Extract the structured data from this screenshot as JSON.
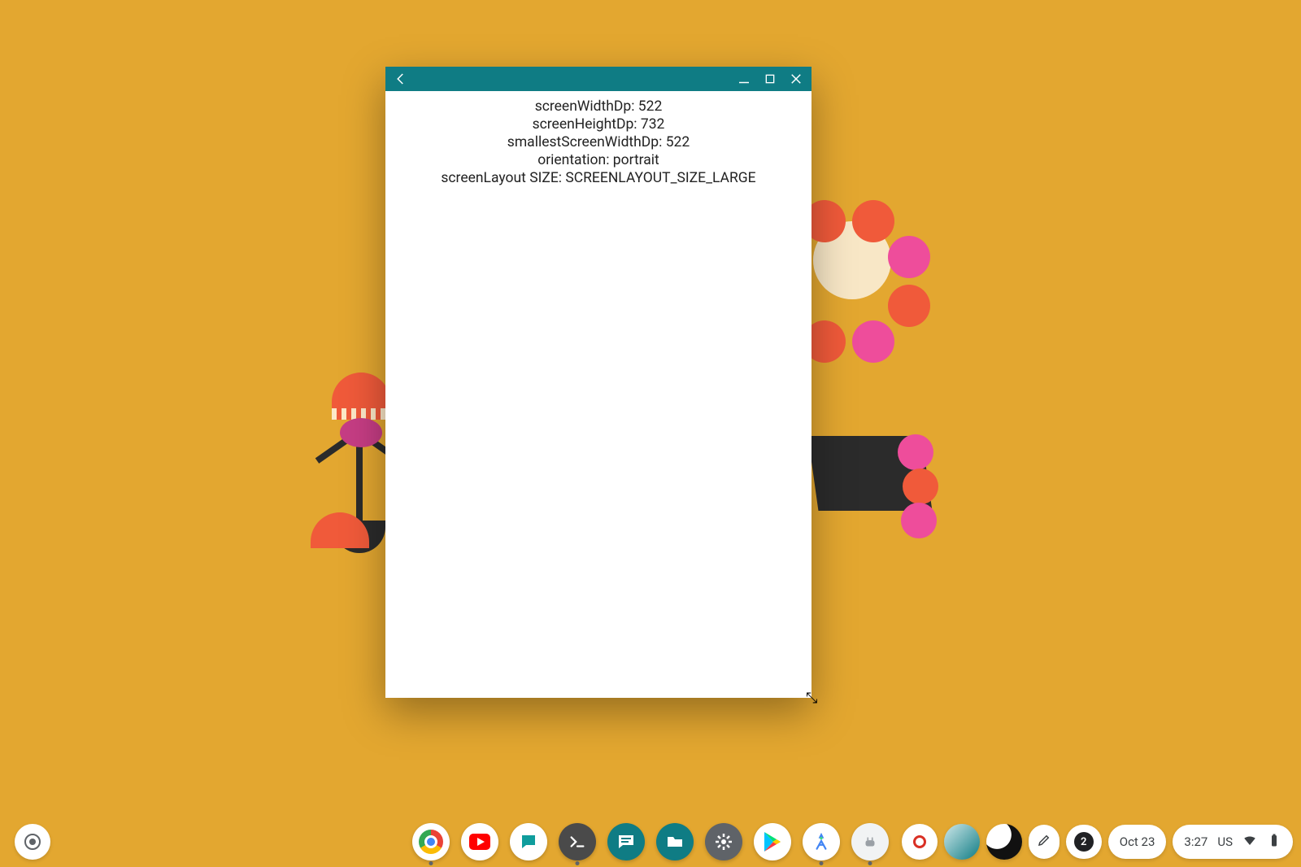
{
  "window": {
    "lines": [
      "screenWidthDp: 522",
      "screenHeightDp: 732",
      "smallestScreenWidthDp: 522",
      "orientation: portrait",
      "screenLayout SIZE: SCREENLAYOUT_SIZE_LARGE"
    ]
  },
  "shelf": {
    "apps": [
      {
        "name": "chrome",
        "label": "Chrome"
      },
      {
        "name": "youtube",
        "label": "YouTube"
      },
      {
        "name": "chat",
        "label": "Chat"
      },
      {
        "name": "terminal",
        "label": "Terminal"
      },
      {
        "name": "messages",
        "label": "Messages"
      },
      {
        "name": "files",
        "label": "Files"
      },
      {
        "name": "settings",
        "label": "Settings"
      },
      {
        "name": "play-store",
        "label": "Play Store"
      },
      {
        "name": "android-studio",
        "label": "Android Studio"
      },
      {
        "name": "generic-app",
        "label": "App"
      }
    ]
  },
  "tray": {
    "notification_count": "2",
    "date": "Oct 23",
    "time": "3:27",
    "ime": "US"
  }
}
